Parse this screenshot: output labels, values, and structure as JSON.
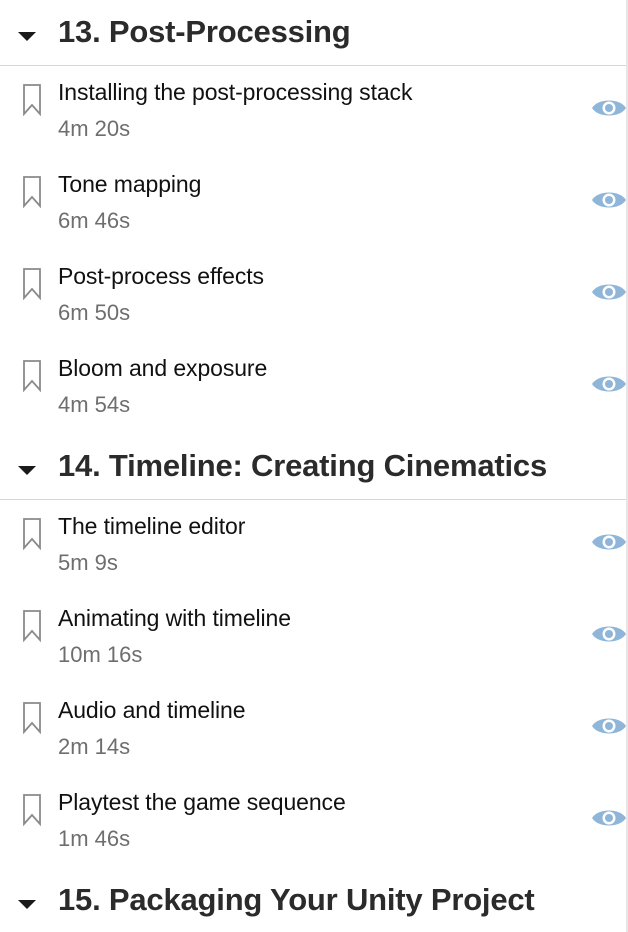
{
  "colors": {
    "eye_icon": "#8fb6d8",
    "title_text": "#111111",
    "duration_text": "#6e6e6e",
    "section_text": "#2b2b2b",
    "divider": "#d6d6d6"
  },
  "sections": [
    {
      "title": "13. Post-Processing",
      "expanded": true,
      "items": [
        {
          "title": "Installing the post-processing stack",
          "duration": "4m 20s"
        },
        {
          "title": "Tone mapping",
          "duration": "6m 46s"
        },
        {
          "title": "Post-process effects",
          "duration": "6m 50s"
        },
        {
          "title": "Bloom and exposure",
          "duration": "4m 54s"
        }
      ]
    },
    {
      "title": "14. Timeline: Creating Cinematics",
      "expanded": true,
      "items": [
        {
          "title": "The timeline editor",
          "duration": "5m 9s"
        },
        {
          "title": "Animating with timeline",
          "duration": "10m 16s"
        },
        {
          "title": "Audio and timeline",
          "duration": "2m 14s"
        },
        {
          "title": "Playtest the game sequence",
          "duration": "1m 46s"
        }
      ]
    },
    {
      "title": "15. Packaging Your Unity Project",
      "expanded": true,
      "items": []
    }
  ]
}
